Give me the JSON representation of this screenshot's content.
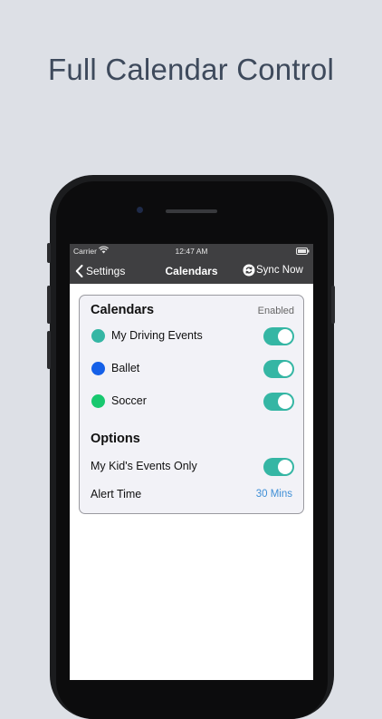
{
  "headline": "Full Calendar Control",
  "status_bar": {
    "carrier": "Carrier",
    "time": "12:47 AM"
  },
  "nav": {
    "back_label": "Settings",
    "title": "Calendars",
    "sync_label": "Sync Now"
  },
  "calendars": {
    "title": "Calendars",
    "enabled_label": "Enabled",
    "items": [
      {
        "label": "My Driving Events",
        "color": "#35b6a4",
        "enabled": true
      },
      {
        "label": "Ballet",
        "color": "#1560e8",
        "enabled": true
      },
      {
        "label": "Soccer",
        "color": "#18c86f",
        "enabled": true
      }
    ]
  },
  "options": {
    "title": "Options",
    "kids_only_label": "My Kid's Events Only",
    "kids_only_enabled": true,
    "alert_label": "Alert Time",
    "alert_value": "30 Mins"
  },
  "colors": {
    "accent": "#35b6a4",
    "link": "#3f8fd6",
    "bar": "#3f3f41"
  }
}
